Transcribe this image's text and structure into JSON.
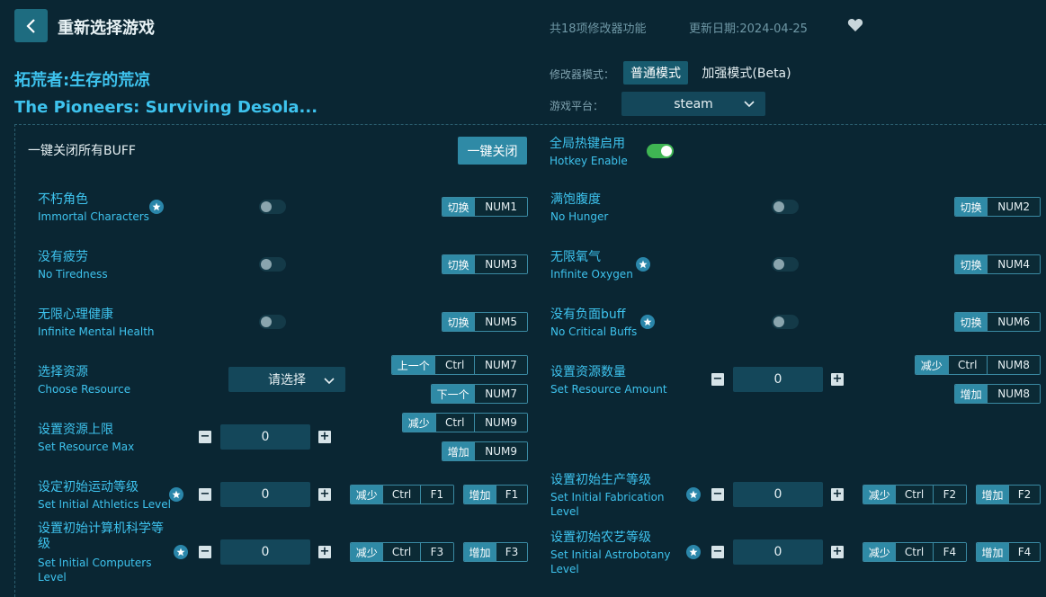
{
  "header": {
    "title": "重新选择游戏",
    "feature_count": "共18项修改器功能",
    "update_date": "更新日期:2024-04-25"
  },
  "game": {
    "name_cn": "拓荒者:生存的荒凉",
    "name_en": "The Pioneers: Surviving Desola..."
  },
  "mode": {
    "label": "修改器模式：",
    "normal": "普通模式",
    "enhanced": "加强模式(Beta)"
  },
  "platform": {
    "label": "游戏平台：",
    "value": "steam"
  },
  "top": {
    "disable_all_label": "一键关闭所有BUFF",
    "disable_all_button": "一键关闭",
    "hotkey_cn": "全局热键启用",
    "hotkey_en": "Hotkey Enable"
  },
  "keys": {
    "toggle": "切换",
    "prev": "上一个",
    "next": "下一个",
    "dec": "减少",
    "inc": "增加",
    "ctrl": "Ctrl"
  },
  "colors": {
    "background": "#0a2633",
    "accent": "#3ec3ee",
    "button": "#2f8aa6",
    "toggle_on": "#3fb553"
  },
  "features": [
    {
      "cn": "不朽角色",
      "en": "Immortal Characters",
      "key": "NUM1"
    },
    {
      "cn": "满饱腹度",
      "en": "No Hunger",
      "key": "NUM2"
    },
    {
      "cn": "没有疲劳",
      "en": "No Tiredness",
      "key": "NUM3"
    },
    {
      "cn": "无限氧气",
      "en": "Infinite Oxygen",
      "key": "NUM4"
    },
    {
      "cn": "无限心理健康",
      "en": "Infinite Mental Health",
      "key": "NUM5"
    },
    {
      "cn": "没有负面buff",
      "en": "No Critical Buffs",
      "key": "NUM6"
    }
  ],
  "resource": {
    "cn": "选择资源",
    "en": "Choose Resource",
    "placeholder": "请选择",
    "prev_key": "NUM7",
    "next_key": "NUM7"
  },
  "amount": {
    "cn": "设置资源数量",
    "en": "Set Resource Amount",
    "value": "0",
    "dec_key": "NUM8",
    "inc_key": "NUM8"
  },
  "max": {
    "cn": "设置资源上限",
    "en": "Set Resource Max",
    "value": "0",
    "dec_key": "NUM9",
    "inc_key": "NUM9"
  },
  "athletics": {
    "cn": "设定初始运动等级",
    "en": "Set Initial Athletics Level",
    "value": "0",
    "dec_key": "F1",
    "inc_key": "F1"
  },
  "fabrication": {
    "cn": "设置初始生产等级",
    "en": "Set Initial Fabrication Level",
    "value": "0",
    "dec_key": "F2",
    "inc_key": "F2"
  },
  "computers": {
    "cn": "设置初始计算机科学等级",
    "en": "Set Initial Computers Level",
    "value": "0",
    "dec_key": "F3",
    "inc_key": "F3"
  },
  "astrobotany": {
    "cn": "设置初始农艺等级",
    "en": "Set Initial Astrobotany Level",
    "value": "0",
    "dec_key": "F4",
    "inc_key": "F4"
  },
  "stepper": {
    "minus": "−",
    "plus": "+"
  }
}
